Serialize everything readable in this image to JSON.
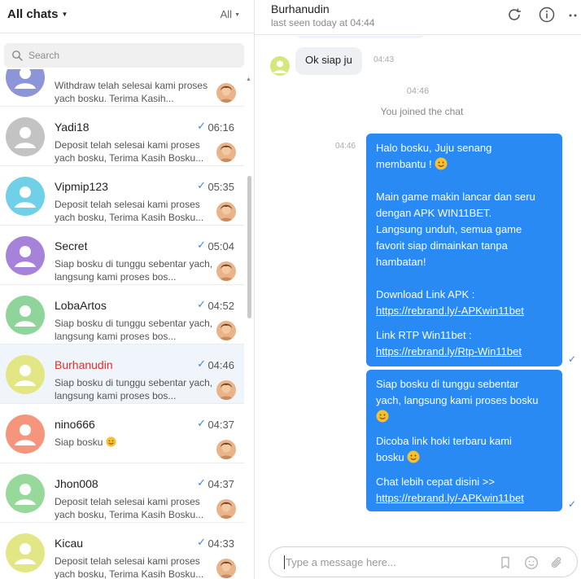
{
  "left_header": {
    "title": "All chats",
    "filter": "All"
  },
  "search": {
    "placeholder": "Search"
  },
  "chats": [
    {
      "name": "",
      "time": "",
      "preview": "Withdraw telah selesai kami proses yach bosku. Terima Kasih...",
      "avatar_color": "#8b95d8",
      "checked": false,
      "active": false
    },
    {
      "name": "Yadi18",
      "time": "06:16",
      "preview": "Deposit telah selesai kami proses yach bosku, Terima Kasih Bosku...",
      "avatar_color": "#c3c3c3",
      "checked": true,
      "active": false
    },
    {
      "name": "Vipmip123",
      "time": "05:35",
      "preview": "Deposit telah selesai kami proses yach bosku, Terima Kasih Bosku...",
      "avatar_color": "#6fd0e8",
      "checked": true,
      "active": false
    },
    {
      "name": "Secret",
      "time": "05:04",
      "preview": "Siap bosku di tunggu sebentar yach, langsung kami proses bos...",
      "avatar_color": "#a683d8",
      "checked": true,
      "active": false
    },
    {
      "name": "LobaArtos",
      "time": "04:52",
      "preview": "Siap bosku di tunggu sebentar yach, langsung kami proses bos...",
      "avatar_color": "#8fd49b",
      "checked": true,
      "active": false
    },
    {
      "name": "Burhanudin",
      "time": "04:46",
      "preview": "Siap bosku di tunggu sebentar yach, langsung kami proses bos...",
      "avatar_color": "#e2e684",
      "checked": true,
      "active": true
    },
    {
      "name": "nino666",
      "time": "04:37",
      "preview": "Siap bosku",
      "avatar_color": "#f4957c",
      "checked": true,
      "active": false
    },
    {
      "name": "Jhon008",
      "time": "04:37",
      "preview": "Deposit telah selesai kami proses yach bosku, Terima Kasih Bosku...",
      "avatar_color": "#97d99a",
      "checked": true,
      "active": false
    },
    {
      "name": "Kicau",
      "time": "04:33",
      "preview": "Deposit telah selesai kami proses yach bosku, Terima Kasih Bosku...",
      "avatar_color": "#e2e684",
      "checked": true,
      "active": false
    }
  ],
  "conversation": {
    "contact_name": "Burhanudin",
    "last_seen": "last seen today at 04:44",
    "incoming": {
      "text": "Ok siap ju",
      "time": "04:43"
    },
    "system_time": "04:46",
    "system_msg": "You joined the chat",
    "outgoing_time": "04:46",
    "bubble1": {
      "line1": "Halo bosku, Juju senang",
      "line2": "membantu !",
      "para2": [
        "Main game makin lancar dan seru",
        "dengan APK WIN11BET.",
        "Langsung unduh, semua game",
        "favorit siap dimainkan tanpa",
        "hambatan!"
      ],
      "apk_label": "Download Link APK :",
      "apk_link": "https://rebrand.ly/-APKwin11bet",
      "rtp_label": "Link RTP Win11bet :",
      "rtp_link": "https://rebrand.ly/Rtp-Win11bet"
    },
    "bubble2": {
      "line1": "Siap bosku di tunggu sebentar",
      "line2": "yach, langsung kami proses bosku",
      "line3": "Dicoba link hoki terbaru kami",
      "line4": "bosku",
      "line5": "Chat lebih cepat disini >>",
      "link": "https://rebrand.ly/-APKwin11bet"
    }
  },
  "input": {
    "placeholder": "Type a message here..."
  },
  "colors": {
    "accent": "#2a8af3",
    "check": "#3d86e0",
    "active_row": "#f0f4fb",
    "active_name": "#d9322c"
  }
}
